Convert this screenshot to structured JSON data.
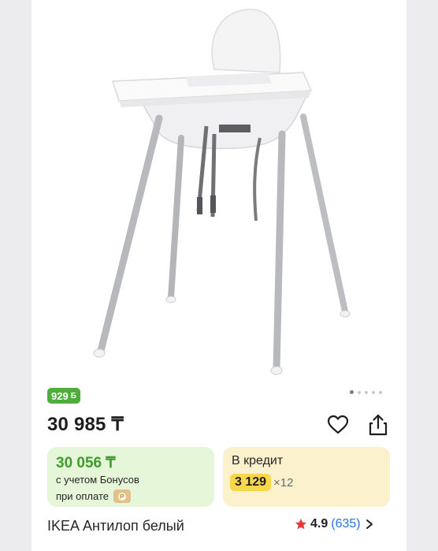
{
  "product": {
    "bonus_badge": "929",
    "price": "30 985 ₸",
    "bonus_price": "30 056 ₸",
    "bonus_note_line1": "с учетом Бонусов",
    "bonus_note_line2": "при оплате",
    "credit_title": "В кредит",
    "credit_monthly": "3 129",
    "credit_months": "×12",
    "title": "IKEA Антилоп белый",
    "rating": "4.9",
    "reviews": "(635)"
  },
  "gallery": {
    "dots_count": 5,
    "active_index": 0
  },
  "colors": {
    "bonus_green": "#4fae3b",
    "bonus_box": "#e6f6d9",
    "credit_box": "#fbf2cd",
    "credit_highlight": "#f9d64a",
    "star": "#e53935",
    "link_blue": "#2a73d9"
  },
  "icons": {
    "favorite": "heart-icon",
    "share": "share-icon",
    "rating": "star-icon",
    "more": "chevron-right-icon",
    "bonus_coin": "bonus-coin-icon",
    "payment_chip": "payment-chip-icon"
  }
}
